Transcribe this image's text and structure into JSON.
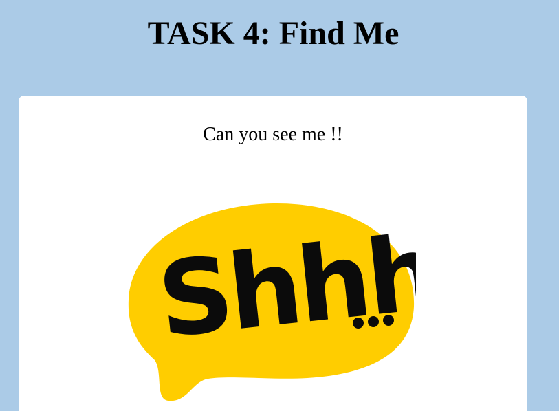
{
  "header": {
    "title": "TASK 4: Find Me"
  },
  "card": {
    "text": "Can you see me !!",
    "image": {
      "icon": "speech-bubble-icon",
      "word": "Shhh",
      "bubble_color": "#ffcd00",
      "text_color": "#0b0b0b"
    }
  },
  "colors": {
    "background": "#abcbe7",
    "card": "#ffffff"
  }
}
